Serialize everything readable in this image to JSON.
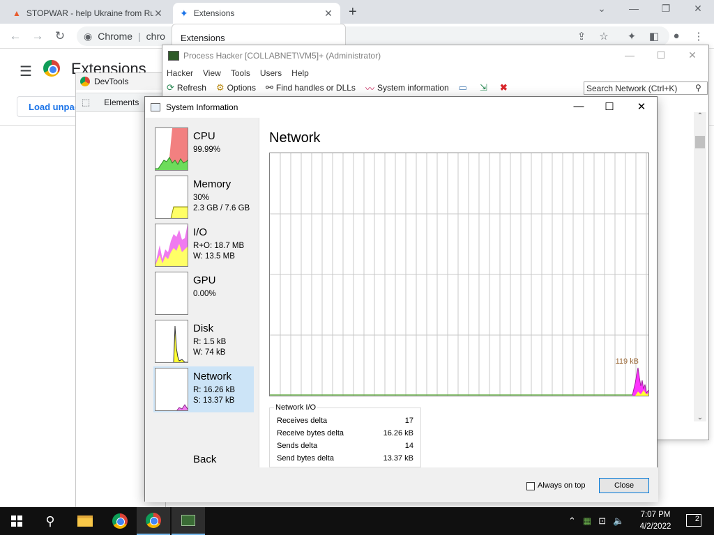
{
  "chrome": {
    "tabs": [
      {
        "label": "STOPWAR - help Ukraine from Ru",
        "close": "✕"
      },
      {
        "label": "Extensions",
        "close": "✕"
      }
    ],
    "new_tab": "+",
    "omnibox": {
      "origin": "Chrome",
      "sep": "|",
      "url": "chro"
    },
    "tab_popup": "Extensions",
    "page": {
      "title": "Extensions",
      "load_unpacked": "Load unpac"
    }
  },
  "devtools": {
    "title": "DevTools",
    "tab_elements": "Elements"
  },
  "process_hacker": {
    "title": "Process Hacker [COLLABNET\\VM5]+ (Administrator)",
    "menu": [
      "Hacker",
      "View",
      "Tools",
      "Users",
      "Help"
    ],
    "toolbar": {
      "refresh": "Refresh",
      "options": "Options",
      "find_handles": "Find handles or DLLs",
      "system_information": "System information"
    },
    "search_placeholder": "Search Network (Ctrl+K)"
  },
  "system_information": {
    "title": "System Information",
    "sidebar": [
      {
        "name": "CPU",
        "line1": "99.99%",
        "line2": ""
      },
      {
        "name": "Memory",
        "line1": "30%",
        "line2": "2.3 GB / 7.6 GB"
      },
      {
        "name": "I/O",
        "line1": "R+O: 18.7 MB",
        "line2": "W: 13.5 MB"
      },
      {
        "name": "GPU",
        "line1": "0.00%",
        "line2": ""
      },
      {
        "name": "Disk",
        "line1": "R: 1.5 kB",
        "line2": "W: 74 kB"
      },
      {
        "name": "Network",
        "line1": "R: 16.26 kB",
        "line2": "S: 13.37 kB"
      }
    ],
    "back": "Back",
    "main_title": "Network",
    "graph_label": "119 kB",
    "network_io": {
      "title": "Network I/O",
      "rows": [
        {
          "label": "Receives delta",
          "value": "17"
        },
        {
          "label": "Receive bytes delta",
          "value": "16.26 kB"
        },
        {
          "label": "Sends delta",
          "value": "14"
        },
        {
          "label": "Send bytes delta",
          "value": "13.37 kB"
        }
      ]
    },
    "always_on_top": "Always on top",
    "close_button": "Close"
  },
  "taskbar": {
    "time": "7:07 PM",
    "date": "4/2/2022",
    "notification_count": "2"
  },
  "colors": {
    "chrome_tabbar": "#dee1e6",
    "selected_item": "#cce4f7",
    "graph_receive": "#ff00ff",
    "graph_send": "#ffff00",
    "graph_grid": "#c8c8c8",
    "taskbar": "#101010"
  }
}
